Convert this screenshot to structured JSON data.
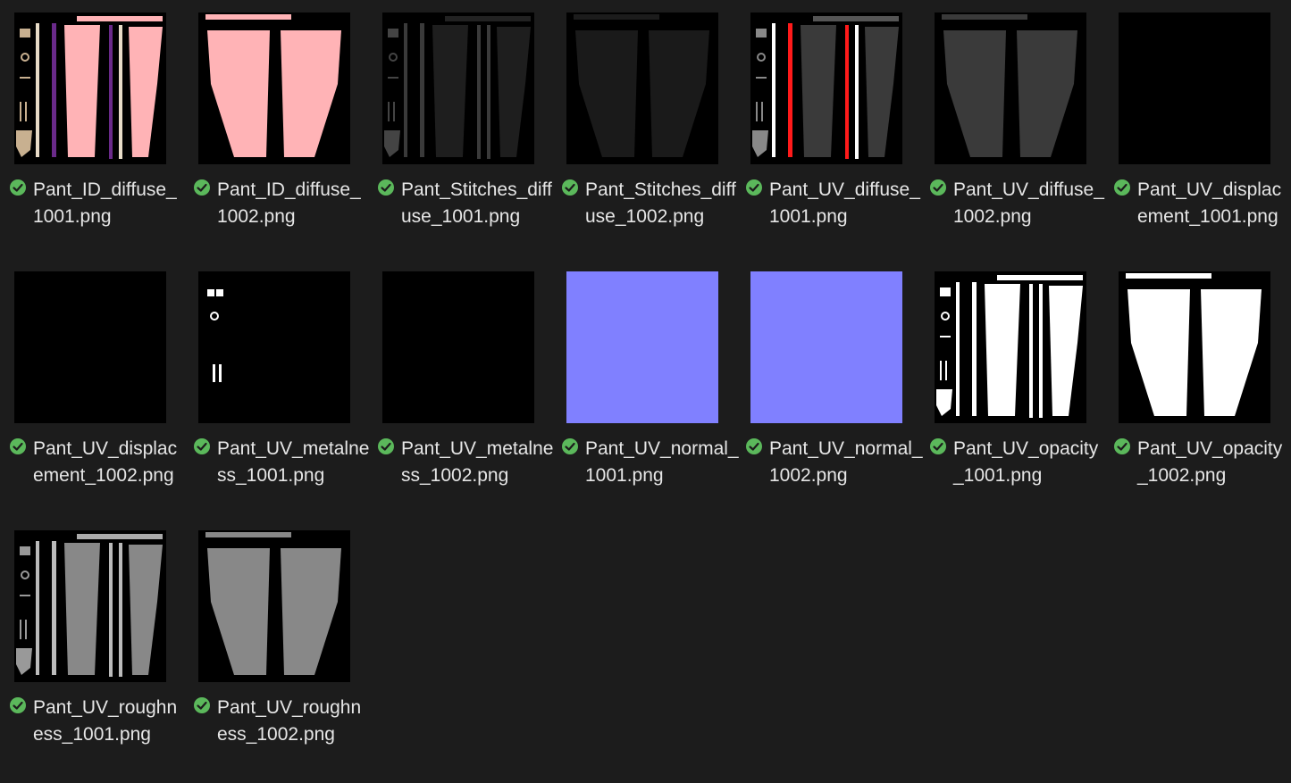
{
  "explorer": {
    "files": [
      {
        "name": "Pant_ID_diffuse_​1001.png",
        "map": "id_full"
      },
      {
        "name": "Pant_ID_diffuse_​1002.png",
        "map": "id_legs"
      },
      {
        "name": "Pant_Stitches_diffuse_1001.png",
        "map": "stitch_full"
      },
      {
        "name": "Pant_Stitches_diffuse_1002.png",
        "map": "stitch_legs"
      },
      {
        "name": "Pant_UV_diffuse_1001.png",
        "map": "diffuse_full"
      },
      {
        "name": "Pant_UV_diffuse_1002.png",
        "map": "diffuse_legs"
      },
      {
        "name": "Pant_UV_displacement_1001.png",
        "map": "black"
      },
      {
        "name": "Pant_UV_displacement_1002.png",
        "map": "black"
      },
      {
        "name": "Pant_UV_metalness_1001.png",
        "map": "metal"
      },
      {
        "name": "Pant_UV_metalness_1002.png",
        "map": "black"
      },
      {
        "name": "Pant_UV_normal_1001.png",
        "map": "normal"
      },
      {
        "name": "Pant_UV_normal_1002.png",
        "map": "normal"
      },
      {
        "name": "Pant_UV_opacity_1001.png",
        "map": "opacity_full"
      },
      {
        "name": "Pant_UV_opacity_1002.png",
        "map": "opacity_legs"
      },
      {
        "name": "Pant_UV_roughness_1001.png",
        "map": "rough_full"
      },
      {
        "name": "Pant_UV_roughness_1002.png",
        "map": "rough_legs"
      }
    ],
    "status_icon": "synced-check-icon",
    "colors": {
      "background": "#1c1c1c",
      "status_green": "#5bb85b",
      "id_pink": "#ffb3b6",
      "id_purple": "#6a2a8a",
      "normal_blue": "#8080ff",
      "diffuse_red": "#ff1a1a"
    }
  }
}
